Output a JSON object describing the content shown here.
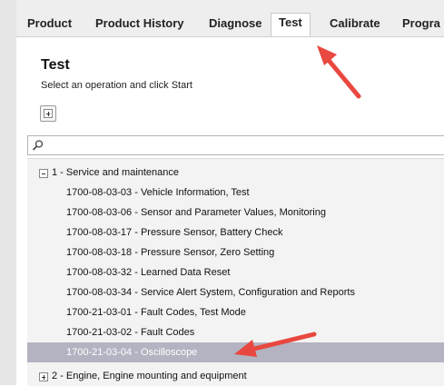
{
  "tabs": [
    {
      "label": "Product"
    },
    {
      "label": "Product History"
    },
    {
      "label": "Diagnose"
    },
    {
      "label": "Test"
    },
    {
      "label": "Calibrate"
    },
    {
      "label": "Progra"
    }
  ],
  "active_tab": "Test",
  "page": {
    "title": "Test",
    "subtitle": "Select an operation and click Start"
  },
  "search": {
    "value": ""
  },
  "tree": {
    "group1": {
      "label": "1 - Service and maintenance",
      "expanded": true
    },
    "items": [
      {
        "label": "1700-08-03-03 - Vehicle Information, Test"
      },
      {
        "label": "1700-08-03-06 - Sensor and Parameter Values, Monitoring"
      },
      {
        "label": "1700-08-03-17 - Pressure Sensor, Battery Check"
      },
      {
        "label": "1700-08-03-18 - Pressure Sensor, Zero Setting"
      },
      {
        "label": "1700-08-03-32 - Learned Data Reset"
      },
      {
        "label": "1700-08-03-34 - Service Alert System, Configuration and Reports"
      },
      {
        "label": "1700-21-03-01 - Fault Codes, Test Mode"
      },
      {
        "label": "1700-21-03-02 - Fault Codes"
      },
      {
        "label": "1700-21-03-04 - Oscilloscope",
        "selected": true
      }
    ],
    "group2": {
      "label": "2 - Engine, Engine mounting and equipment",
      "expanded": false
    }
  },
  "colors": {
    "selection": "#b3b3c2",
    "annotation_arrow": "#e8483f"
  },
  "icons": {
    "expand_all": "plus-box-icon",
    "search": "magnifier-icon"
  }
}
